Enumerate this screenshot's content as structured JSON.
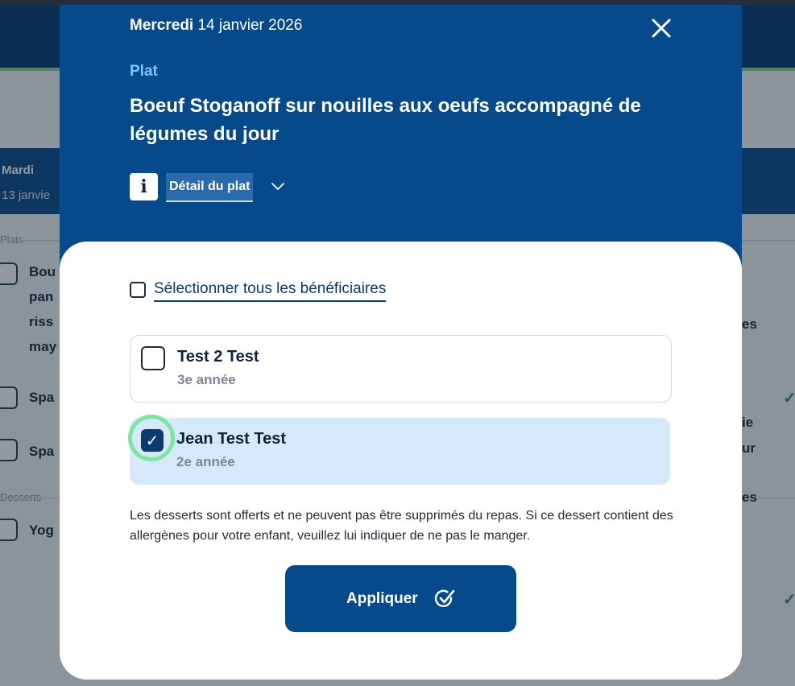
{
  "background": {
    "day_name": "Mardi",
    "day_date": "13 janvie",
    "section_plats": "Plats",
    "section_desserts": "Desserts",
    "item_1_lines": [
      "Bou",
      "pan",
      "riss",
      "may"
    ],
    "item_2": "Spa",
    "item_3": "Spa",
    "item_4": "Yog",
    "right_fragments": [
      "es",
      "ie",
      "ur",
      "es"
    ]
  },
  "modal": {
    "date_weekday": "Mercredi",
    "date_rest": " 14 janvier 2026",
    "close_icon": "close-icon",
    "category": "Plat",
    "dish_title": "Boeuf Stoganoff sur nouilles aux oeufs accompagné de légumes du jour",
    "info_icon_glyph": "i",
    "detail_label": "Détail du plat",
    "select_all_label": "Sélectionner tous les bénéficiaires",
    "beneficiaries": [
      {
        "name": "Test 2 Test",
        "grade": "3e année",
        "checked": false
      },
      {
        "name": "Jean Test Test",
        "grade": "2e année",
        "checked": true
      }
    ],
    "check_glyph": "✓",
    "note": "Les desserts sont offerts et ne peuvent pas être supprimés du repas. Si ce dessert contient des allergènes pour votre enfant, veuillez lui indiquer de ne pas le manger.",
    "apply_label": "Appliquer"
  },
  "colors": {
    "header_blue": "#064a8c",
    "accent_light_blue": "#7ec3ff",
    "selected_bg": "#d5e9fb",
    "focus_green": "#7be6a0"
  }
}
